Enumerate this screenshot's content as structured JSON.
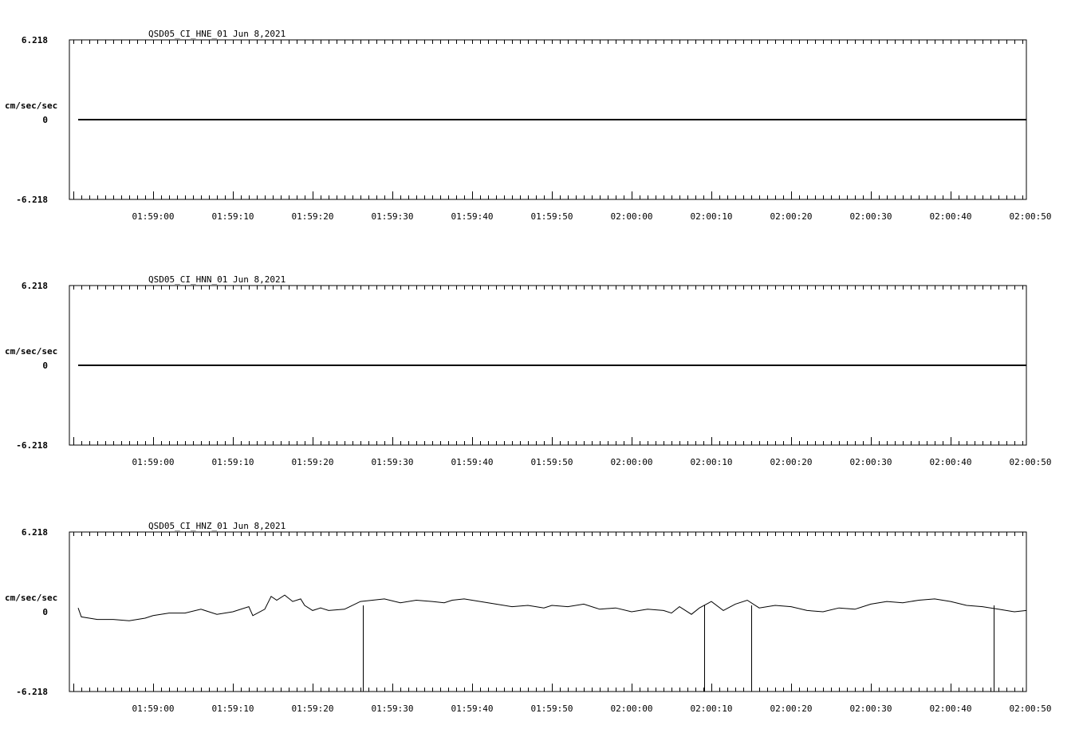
{
  "chart_data": [
    {
      "type": "line",
      "title": "QSD05_CI_HNE_01  Jun 8,2021",
      "ylabel": "cm/sec/sec",
      "ylim": [
        -6.218,
        6.218
      ],
      "ytick_labels": [
        "6.218",
        "0",
        "-6.218"
      ],
      "xtick_labels": [
        "01:59:00",
        "01:59:10",
        "01:59:20",
        "01:59:30",
        "01:59:40",
        "01:59:50",
        "02:00:00",
        "02:00:10",
        "02:00:20",
        "02:00:30",
        "02:00:40",
        "02:00:50"
      ],
      "x_range_seconds": [
        -10.5,
        109.5
      ],
      "x_start_seconds": -9.4,
      "series": [
        {
          "values": [
            0,
            0
          ]
        }
      ],
      "grid": false
    },
    {
      "type": "line",
      "title": "QSD05_CI_HNN_01  Jun 8,2021",
      "ylabel": "cm/sec/sec",
      "ylim": [
        -6.218,
        6.218
      ],
      "ytick_labels": [
        "6.218",
        "0",
        "-6.218"
      ],
      "xtick_labels": [
        "01:59:00",
        "01:59:10",
        "01:59:20",
        "01:59:30",
        "01:59:40",
        "01:59:50",
        "02:00:00",
        "02:00:10",
        "02:00:20",
        "02:00:30",
        "02:00:40",
        "02:00:50"
      ],
      "x_range_seconds": [
        -10.5,
        109.5
      ],
      "x_start_seconds": -9.4,
      "series": [
        {
          "values": [
            0,
            0
          ]
        }
      ],
      "grid": false
    },
    {
      "type": "line",
      "title": "QSD05_CI_HNZ_01  Jun 8,2021",
      "ylabel": "cm/sec/sec",
      "ylim": [
        -6.218,
        6.218
      ],
      "ytick_labels": [
        "6.218",
        "0",
        "-6.218"
      ],
      "xtick_labels": [
        "01:59:00",
        "01:59:10",
        "01:59:20",
        "01:59:30",
        "01:59:40",
        "01:59:50",
        "02:00:00",
        "02:00:10",
        "02:00:20",
        "02:00:30",
        "02:00:40",
        "02:00:50"
      ],
      "x_range_seconds": [
        -10.5,
        109.5
      ],
      "series": [
        {
          "x": [
            -9.4,
            -9,
            -8,
            -7,
            -5,
            -3,
            -1,
            0,
            2,
            4,
            6,
            8,
            10,
            12,
            12.5,
            14,
            14.8,
            15.5,
            16.5,
            17.5,
            18.5,
            19,
            20,
            21,
            22,
            24,
            26,
            27.5,
            29,
            31,
            33,
            35,
            36.5,
            37.5,
            39,
            41,
            43,
            45,
            47,
            49,
            50,
            52,
            54,
            56,
            58,
            60,
            62,
            64,
            65,
            66,
            67.5,
            68.5,
            70,
            71.5,
            73,
            74.5,
            76,
            78,
            80,
            82,
            84,
            86,
            88,
            90,
            92,
            94,
            96,
            98,
            100,
            102,
            104,
            106,
            108,
            109.5
          ],
          "y": [
            0.3,
            -0.4,
            -0.5,
            -0.6,
            -0.6,
            -0.7,
            -0.5,
            -0.3,
            -0.1,
            -0.1,
            0.2,
            -0.2,
            0.0,
            0.4,
            -0.3,
            0.2,
            1.2,
            0.9,
            1.3,
            0.8,
            1.0,
            0.5,
            0.1,
            0.3,
            0.1,
            0.2,
            0.8,
            0.9,
            1.0,
            0.7,
            0.9,
            0.8,
            0.7,
            0.9,
            1.0,
            0.8,
            0.6,
            0.4,
            0.5,
            0.3,
            0.5,
            0.4,
            0.6,
            0.2,
            0.3,
            0.0,
            0.2,
            0.1,
            -0.1,
            0.4,
            -0.2,
            0.3,
            0.8,
            0.1,
            0.6,
            0.9,
            0.3,
            0.5,
            0.4,
            0.1,
            0.0,
            0.3,
            0.2,
            0.6,
            0.8,
            0.7,
            0.9,
            1.0,
            0.8,
            0.5,
            0.4,
            0.2,
            0.0,
            0.1
          ]
        }
      ],
      "spikes": [
        {
          "x": 26.3,
          "y": -9.3
        },
        {
          "x": 69.1,
          "y": -12.0
        },
        {
          "x": 75.0,
          "y": -12.0
        },
        {
          "x": 75.0,
          "y": -10.3
        },
        {
          "x": 105.4,
          "y": -9.8
        }
      ],
      "grid": false
    }
  ]
}
